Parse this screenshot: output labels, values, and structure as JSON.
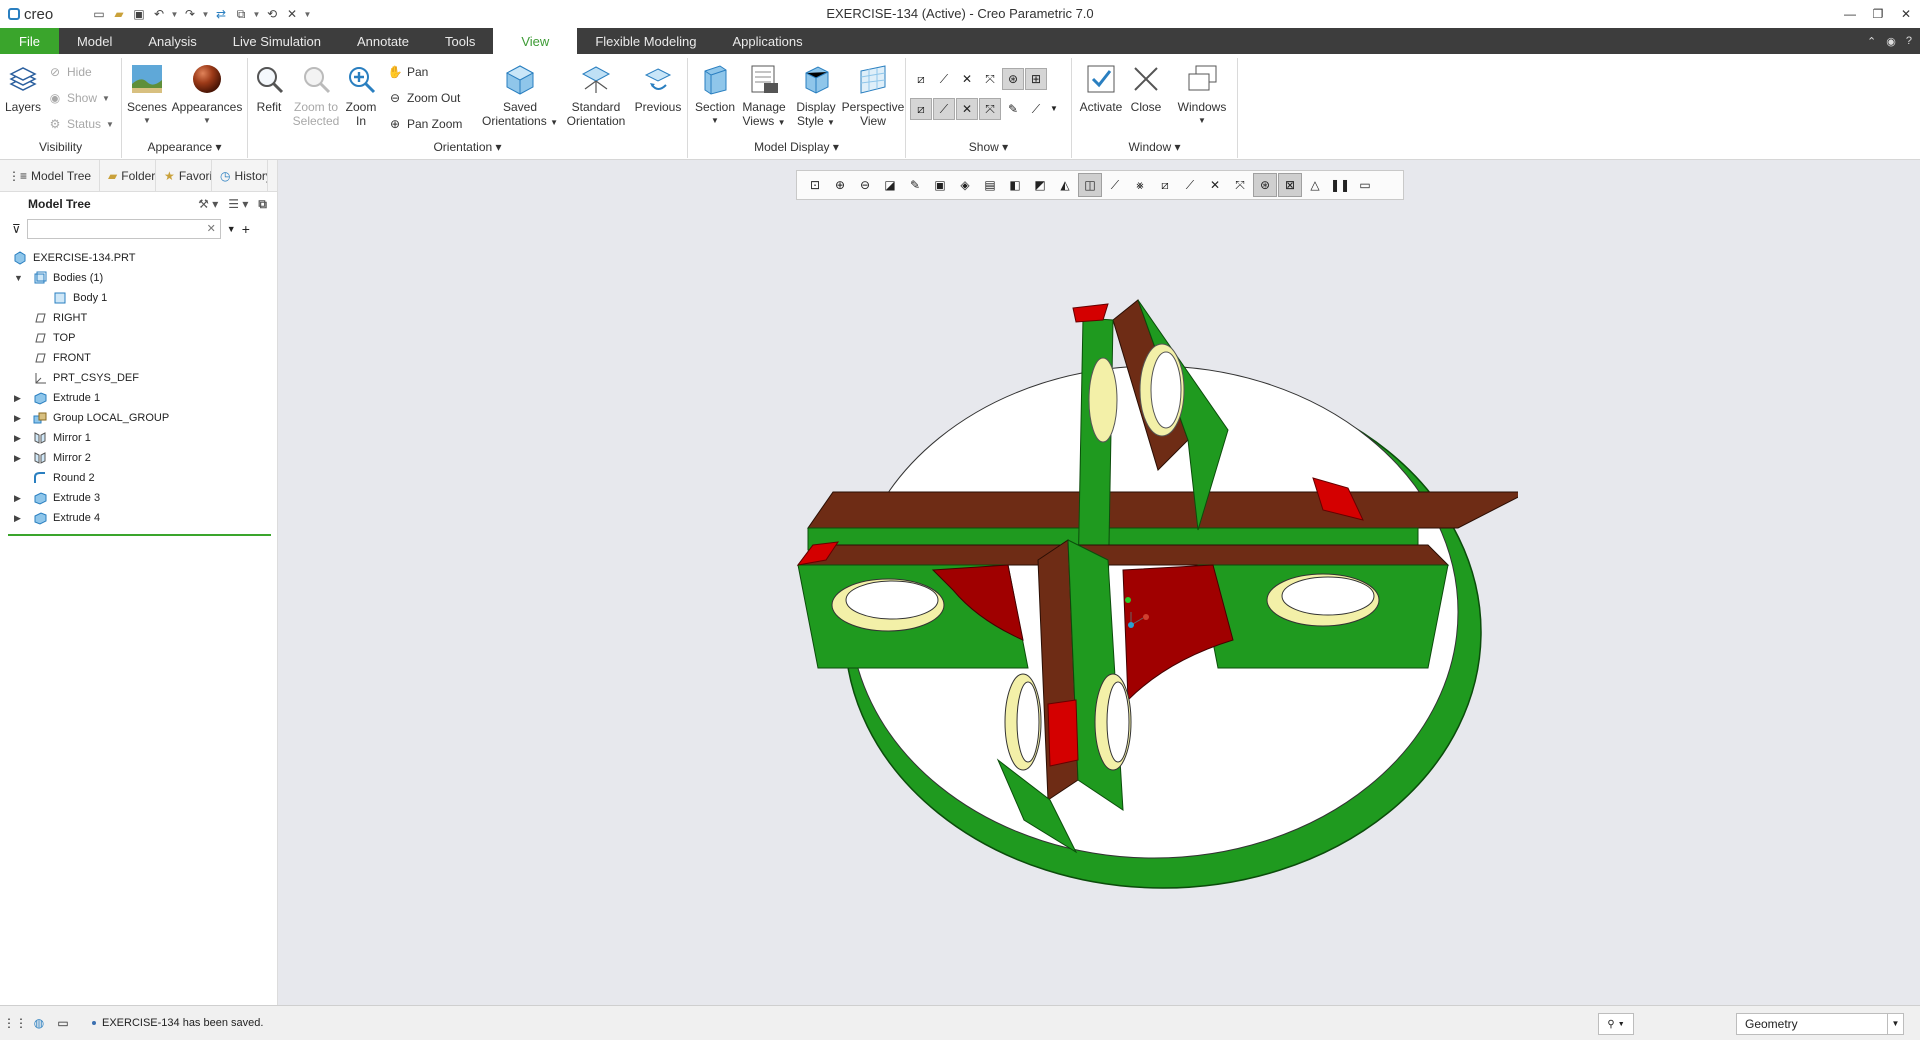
{
  "app": {
    "logo_text": "creo",
    "window_title": "EXERCISE-134 (Active) - Creo Parametric 7.0"
  },
  "tabs": [
    {
      "label": "File"
    },
    {
      "label": "Model"
    },
    {
      "label": "Analysis"
    },
    {
      "label": "Live Simulation"
    },
    {
      "label": "Annotate"
    },
    {
      "label": "Tools"
    },
    {
      "label": "View"
    },
    {
      "label": "Flexible Modeling"
    },
    {
      "label": "Applications"
    }
  ],
  "ribbon": {
    "visibility": {
      "label": "Visibility",
      "layers": "Layers",
      "hide": "Hide",
      "show": "Show",
      "status": "Status"
    },
    "appearance": {
      "label": "Appearance",
      "scenes": "Scenes",
      "appearances": "Appearances"
    },
    "orientation": {
      "label": "Orientation",
      "refit": "Refit",
      "zoom_selected_1": "Zoom to",
      "zoom_selected_2": "Selected",
      "zoom_in_1": "Zoom",
      "zoom_in_2": "In",
      "pan": "Pan",
      "zoom_out": "Zoom Out",
      "pan_zoom": "Pan Zoom",
      "saved_1": "Saved",
      "saved_2": "Orientations",
      "standard_1": "Standard",
      "standard_2": "Orientation",
      "previous": "Previous"
    },
    "model_display": {
      "label": "Model Display",
      "section": "Section",
      "manage_1": "Manage",
      "manage_2": "Views",
      "display_1": "Display",
      "display_2": "Style",
      "perspective_1": "Perspective",
      "perspective_2": "View"
    },
    "show": {
      "label": "Show"
    },
    "window": {
      "label": "Window",
      "activate": "Activate",
      "close": "Close",
      "windows": "Windows"
    }
  },
  "left_panel": {
    "tabs": [
      {
        "label": "Model Tree"
      },
      {
        "label": "Folder Browser"
      },
      {
        "label": "Favorites"
      },
      {
        "label": "History"
      }
    ],
    "header": "Model Tree",
    "search": {
      "value": "",
      "placeholder": ""
    },
    "tree": [
      {
        "label": "EXERCISE-134.PRT",
        "expander": "",
        "indent": 0,
        "icon": "part-icon"
      },
      {
        "label": "Bodies (1)",
        "expander": "▼",
        "indent": 1,
        "icon": "bodies-icon"
      },
      {
        "label": "Body 1",
        "expander": "",
        "indent": 2,
        "icon": "body-icon"
      },
      {
        "label": "RIGHT",
        "expander": "",
        "indent": 1,
        "icon": "datum-plane-icon"
      },
      {
        "label": "TOP",
        "expander": "",
        "indent": 1,
        "icon": "datum-plane-icon"
      },
      {
        "label": "FRONT",
        "expander": "",
        "indent": 1,
        "icon": "datum-plane-icon"
      },
      {
        "label": "PRT_CSYS_DEF",
        "expander": "",
        "indent": 1,
        "icon": "csys-icon"
      },
      {
        "label": "Extrude 1",
        "expander": "▶",
        "indent": 1,
        "icon": "extrude-icon"
      },
      {
        "label": "Group LOCAL_GROUP",
        "expander": "▶",
        "indent": 1,
        "icon": "group-icon"
      },
      {
        "label": "Mirror 1",
        "expander": "▶",
        "indent": 1,
        "icon": "mirror-icon"
      },
      {
        "label": "Mirror 2",
        "expander": "▶",
        "indent": 1,
        "icon": "mirror-icon"
      },
      {
        "label": "Round 2",
        "expander": "",
        "indent": 1,
        "icon": "round-icon"
      },
      {
        "label": "Extrude 3",
        "expander": "▶",
        "indent": 1,
        "icon": "extrude-icon"
      },
      {
        "label": "Extrude 4",
        "expander": "▶",
        "indent": 1,
        "icon": "extrude-icon"
      }
    ]
  },
  "status": {
    "message": "EXERCISE-134 has been saved.",
    "selection_filter": "Geometry"
  },
  "colors": {
    "accent_green": "#3aa52c",
    "model_green": "#1f9a1f",
    "model_brown": "#6e2c15",
    "model_red": "#b00000",
    "hole_yellow": "#f3f0a8"
  }
}
